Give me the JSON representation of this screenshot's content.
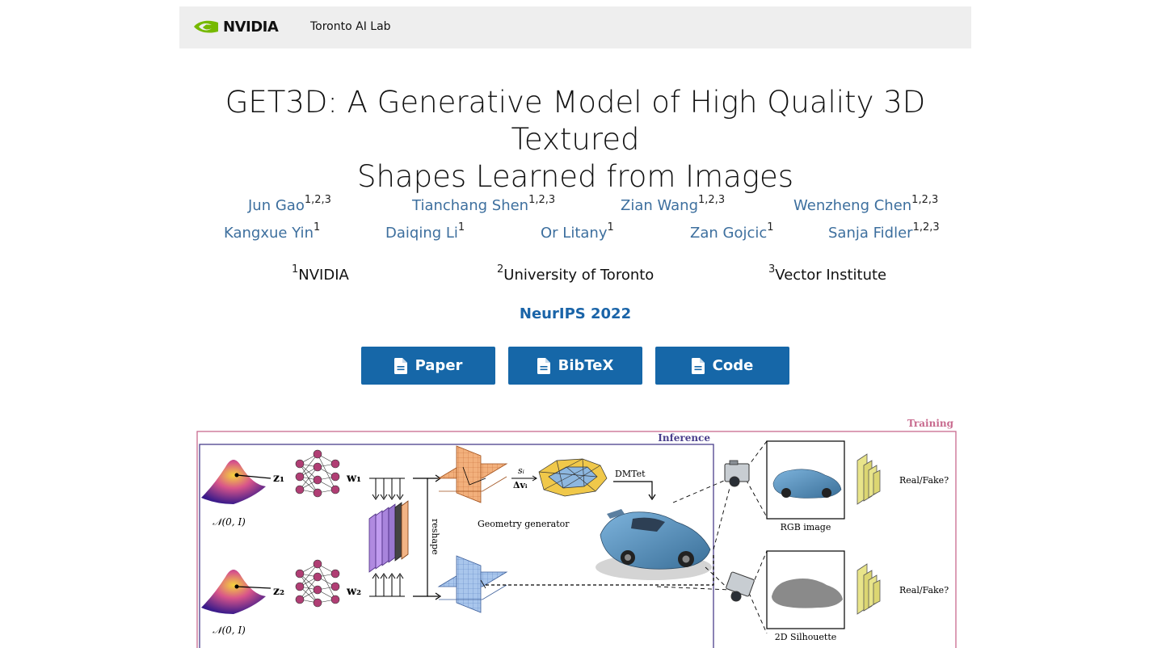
{
  "header": {
    "brand": "NVIDIA",
    "lab": "Toronto AI Lab"
  },
  "title_line1": "GET3D: A Generative Model of High Quality 3D Textured",
  "title_line2": "Shapes Learned from Images",
  "authors_row1": [
    {
      "name": "Jun Gao",
      "sup": "1,2,3"
    },
    {
      "name": "Tianchang Shen",
      "sup": "1,2,3"
    },
    {
      "name": "Zian Wang",
      "sup": "1,2,3"
    },
    {
      "name": "Wenzheng Chen",
      "sup": "1,2,3"
    }
  ],
  "authors_row2": [
    {
      "name": "Kangxue Yin",
      "sup": "1"
    },
    {
      "name": "Daiqing Li",
      "sup": "1"
    },
    {
      "name": "Or Litany",
      "sup": "1"
    },
    {
      "name": "Zan Gojcic",
      "sup": "1"
    },
    {
      "name": "Sanja Fidler",
      "sup": "1,2,3"
    }
  ],
  "affiliations": [
    {
      "sup": "1",
      "name": "NVIDIA"
    },
    {
      "sup": "2",
      "name": "University of Toronto"
    },
    {
      "sup": "3",
      "name": "Vector Institute"
    }
  ],
  "venue": "NeurIPS 2022",
  "buttons": [
    {
      "label": "Paper",
      "icon": "file-icon"
    },
    {
      "label": "BibTeX",
      "icon": "file-icon"
    },
    {
      "label": "Code",
      "icon": "file-icon"
    }
  ],
  "figure": {
    "training_label": "Training",
    "inference_label": "Inference",
    "z1": "z₁",
    "z2": "z₂",
    "w1": "w₁",
    "w2": "w₂",
    "normal_label": "𝒩(0, I)",
    "reshape": "reshape",
    "si": "sᵢ",
    "dv": "Δvᵢ",
    "dmtet": "DMTet",
    "geometry_generator": "Geometry generator",
    "rgb_image": "RGB image",
    "silhouette": "2D Silhouette",
    "real_fake": "Real/Fake?"
  },
  "colors": {
    "accent": "#1667a8",
    "author_link": "#3d6f9e",
    "nvidia_green": "#76b900",
    "training_border": "#c86a8e",
    "inference_border": "#4a3f8c"
  }
}
